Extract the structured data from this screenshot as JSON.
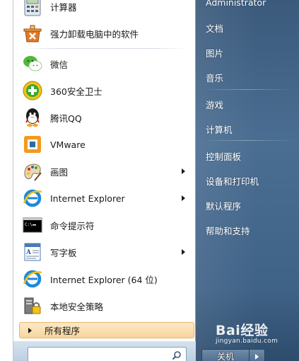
{
  "programs": [
    {
      "label": "计算器",
      "icon": "calculator-icon",
      "has_submenu": false
    },
    {
      "label": "强力卸载电脑中的软件",
      "icon": "uninstall-icon",
      "has_submenu": false
    },
    {
      "label": "微信",
      "icon": "wechat-icon",
      "has_submenu": false
    },
    {
      "label": "360安全卫士",
      "icon": "360-security-icon",
      "has_submenu": false
    },
    {
      "label": "腾讯QQ",
      "icon": "qq-icon",
      "has_submenu": false
    },
    {
      "label": "VMware",
      "icon": "vmware-icon",
      "has_submenu": false
    },
    {
      "label": "画图",
      "icon": "paint-icon",
      "has_submenu": true
    },
    {
      "label": "Internet Explorer",
      "icon": "internet-explorer-icon",
      "has_submenu": true
    },
    {
      "label": "命令提示符",
      "icon": "command-prompt-icon",
      "has_submenu": false
    },
    {
      "label": "写字板",
      "icon": "wordpad-icon",
      "has_submenu": true
    },
    {
      "label": "Internet Explorer (64 位)",
      "icon": "internet-explorer-icon",
      "has_submenu": false
    },
    {
      "label": "本地安全策略",
      "icon": "security-policy-icon",
      "has_submenu": false
    }
  ],
  "all_programs_label": "所有程序",
  "search": {
    "placeholder": "",
    "value": ""
  },
  "right_links": {
    "user": "Administrator",
    "documents": "文档",
    "pictures": "图片",
    "music": "音乐",
    "games": "游戏",
    "computer": "计算机",
    "control_panel": "控制面板",
    "devices_printers": "设备和打印机",
    "default_programs": "默认程序",
    "help_support": "帮助和支持"
  },
  "shutdown_label": "关机",
  "watermark": {
    "main": "Bai经验",
    "sub": "jingyan.baidu.com"
  },
  "colors": {
    "right_pane": "#4a6e92",
    "all_programs_highlight": "#f8d59b"
  }
}
